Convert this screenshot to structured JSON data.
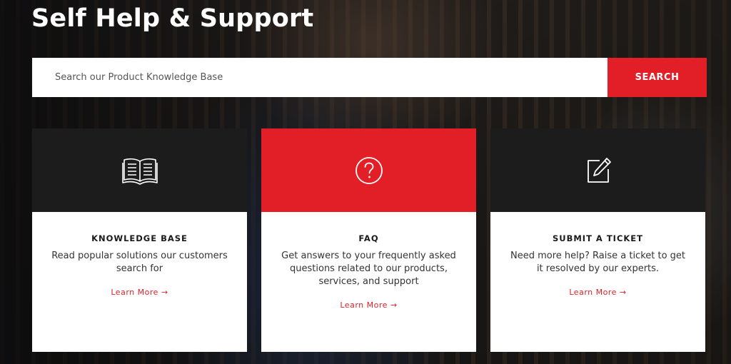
{
  "hero": {
    "title": "Self Help & Support"
  },
  "search": {
    "placeholder": "Search our Product Knowledge Base",
    "button_label": "SEARCH"
  },
  "colors": {
    "accent": "#e21e26",
    "dark_panel": "#1d1c1d",
    "card_bg": "#ffffff"
  },
  "cards": [
    {
      "icon": "book-icon",
      "title": "KNOWLEDGE BASE",
      "description": "Read popular solutions our customers search for",
      "link": "Learn More →",
      "top_color": "#1d1c1d"
    },
    {
      "icon": "question-circle-icon",
      "title": "FAQ",
      "description": "Get answers to your frequently asked questions related to our products, services, and support",
      "link": "Learn More →",
      "top_color": "#e21e26"
    },
    {
      "icon": "edit-icon",
      "title": "SUBMIT A TICKET",
      "description": "Need more help? Raise a ticket to get it resolved by our experts.",
      "link": "Learn More →",
      "top_color": "#1d1c1d"
    }
  ]
}
